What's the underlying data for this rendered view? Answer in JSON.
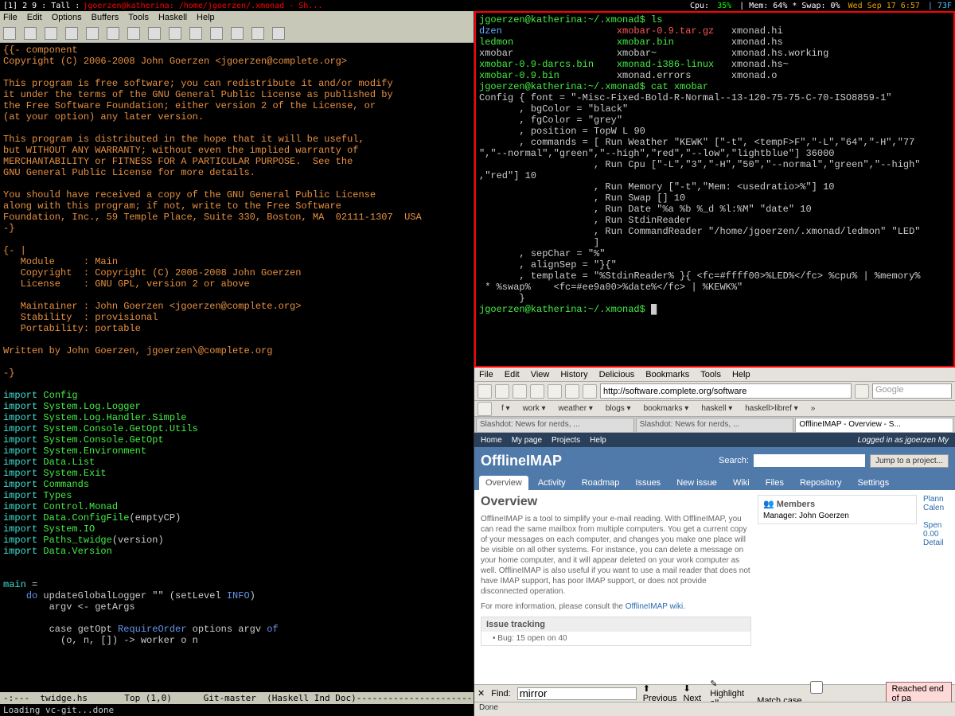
{
  "statusbar": {
    "workspaces": "[1] 2 9 : Tall : ",
    "title": "jgoerzen@katherina: /home/jgoerzen/.xmonad - Sh...",
    "cpu_label": "Cpu:",
    "cpu_val": "35%",
    "mem": "| Mem: 64% * Swap: 0%",
    "date": "Wed Sep 17  6:57",
    "temp": "|  73F"
  },
  "emacs": {
    "menu": [
      "File",
      "Edit",
      "Options",
      "Buffers",
      "Tools",
      "Haskell",
      "Help"
    ],
    "header": "{{- component\nCopyright (C) 2006-2008 John Goerzen <jgoerzen@complete.org>\n\nThis program is free software; you can redistribute it and/or modify\nit under the terms of the GNU General Public License as published by\nthe Free Software Foundation; either version 2 of the License, or\n(at your option) any later version.\n\nThis program is distributed in the hope that it will be useful,\nbut WITHOUT ANY WARRANTY; without even the implied warranty of\nMERCHANTABILITY or FITNESS FOR A PARTICULAR PURPOSE.  See the\nGNU General Public License for more details.\n\nYou should have received a copy of the GNU General Public License\nalong with this program; if not, write to the Free Software\nFoundation, Inc., 59 Temple Place, Suite 330, Boston, MA  02111-1307  USA\n-}\n\n{- |\n   Module     : Main\n   Copyright  : Copyright (C) 2006-2008 John Goerzen\n   License    : GNU GPL, version 2 or above\n\n   Maintainer : John Goerzen <jgoerzen@complete.org>\n   Stability  : provisional\n   Portability: portable\n\nWritten by John Goerzen, jgoerzen\\@complete.org\n\n-}\n",
    "imports": [
      {
        "m": "Config"
      },
      {
        "m": "System.Log.Logger"
      },
      {
        "m": "System.Log.Handler.Simple"
      },
      {
        "m": "System.Console.GetOpt.Utils"
      },
      {
        "m": "System.Console.GetOpt"
      },
      {
        "m": "System.Environment"
      },
      {
        "m": "Data.List"
      },
      {
        "m": "System.Exit"
      },
      {
        "m": "Commands"
      },
      {
        "m": "Types"
      },
      {
        "m": "Control.Monad"
      },
      {
        "m": "Data.ConfigFile",
        "extra": "(emptyCP)"
      },
      {
        "m": "System.IO"
      },
      {
        "m": "Paths_twidge",
        "extra": "(version)"
      },
      {
        "m": "Data.Version"
      }
    ],
    "main_kw": "main",
    "main_eq": " =",
    "main_do": "do",
    "main_l1": " updateGlobalLogger \"\" (setLevel ",
    "main_info": "INFO",
    "main_l1b": ")",
    "main_l2": "        argv <- getArgs",
    "main_l3a": "        case",
    "main_l3b": " getOpt ",
    "main_req": "RequireOrder",
    "main_l3c": " options argv ",
    "main_of": "of",
    "main_l4": "          (o, n, []) -> worker o n",
    "modeline": "-:---  twidge.hs       Top (1,0)      Git-master  (Haskell Ind Doc)----------------------------",
    "minibuffer": "Loading vc-git...done"
  },
  "terminal": {
    "prompt1": "jgoerzen@katherina:~/.xmonad$ ls",
    "ls_c1": [
      "dzen",
      "ledmon",
      "xmobar",
      "xmobar-0.9-darcs.bin",
      "xmobar-0.9.bin"
    ],
    "ls_c2": [
      "xmobar-0.9.tar.gz",
      "xmobar.bin",
      "xmobar~",
      "xmonad-i386-linux",
      "xmonad.errors"
    ],
    "ls_c3": [
      "xmonad.hi",
      "xmonad.hs",
      "xmonad.hs.working",
      "xmonad.hs~",
      "xmonad.o"
    ],
    "prompt2": "jgoerzen@katherina:~/.xmonad$ cat xmobar",
    "config": "Config { font = \"-Misc-Fixed-Bold-R-Normal--13-120-75-75-C-70-ISO8859-1\"\n       , bgColor = \"black\"\n       , fgColor = \"grey\"\n       , position = TopW L 90\n       , commands = [ Run Weather \"KEWK\" [\"-t\", <tempF>F\",\"-L\",\"64\",\"-H\",\"77\n\",\"--normal\",\"green\",\"--high\",\"red\",\"--low\",\"lightblue\"] 36000\n                    , Run Cpu [\"-L\",\"3\",\"-H\",\"50\",\"--normal\",\"green\",\"--high\"\n,\"red\"] 10\n                    , Run Memory [\"-t\",\"Mem: <usedratio>%\"] 10\n                    , Run Swap [] 10\n                    , Run Date \"%a %b %_d %l:%M\" \"date\" 10\n                    , Run StdinReader\n                    , Run CommandReader \"/home/jgoerzen/.xmonad/ledmon\" \"LED\"\n                    ]\n       , sepChar = \"%\"\n       , alignSep = \"}{\"\n       , template = \"%StdinReader% }{ <fc=#ffff00>%LED%</fc> %cpu% | %memory%\n * %swap%    <fc=#ee9a00>%date%</fc> | %KEWK%\"\n       }",
    "prompt3": "jgoerzen@katherina:~/.xmonad$ "
  },
  "browser": {
    "menu": [
      "File",
      "Edit",
      "View",
      "History",
      "Delicious",
      "Bookmarks",
      "Tools",
      "Help"
    ],
    "url": "http://software.complete.org/software",
    "search_placeholder": "Google",
    "bookmarks": [
      "f ▾",
      "work ▾",
      "weather ▾",
      "blogs ▾",
      "bookmarks ▾",
      "haskell ▾",
      "haskell>libref ▾",
      "»"
    ],
    "tabs": [
      "Slashdot: News for nerds, ...",
      "Slashdot: News for nerds, ...",
      "OfflineIMAP - Overview - S..."
    ],
    "active_tab": 2,
    "header_links": [
      "Home",
      "My page",
      "Projects",
      "Help"
    ],
    "login": "Logged in as jgoerzen My",
    "title": "OfflineIMAP",
    "search_label": "Search:",
    "jump": "Jump to a project...",
    "ptabs": [
      "Overview",
      "Activity",
      "Roadmap",
      "Issues",
      "New issue",
      "Wiki",
      "Files",
      "Repository",
      "Settings"
    ],
    "h2": "Overview",
    "para": "OfflineIMAP is a tool to simplify your e-mail reading. With OfflineIMAP, you can read the same mailbox from multiple computers. You get a current copy of your messages on each computer, and changes you make one place will be visible on all other systems. For instance, you can delete a message on your home computer, and it will appear deleted on your work computer as well. OfflineIMAP is also useful if you want to use a mail reader that does not have IMAP support, has poor IMAP support, or does not provide disconnected operation.",
    "more": "For more information, please consult the ",
    "wiki_link": "OfflineIMAP wiki",
    "issue_hdr": "Issue tracking",
    "issue_line": "Bug: 15 open on 40",
    "members_hdr": "Members",
    "members_lbl": "Manager: ",
    "members_name": "John Goerzen",
    "side2": [
      "Plann",
      "Calen",
      "Spen",
      "0.00",
      "Detail"
    ],
    "find_label": "Find:",
    "find_value": "mirror",
    "find_prev": "Previous",
    "find_next": "Next",
    "find_hl": "Highlight all",
    "find_match": "Match case",
    "find_end": "Reached end of pa",
    "status": "Done"
  }
}
